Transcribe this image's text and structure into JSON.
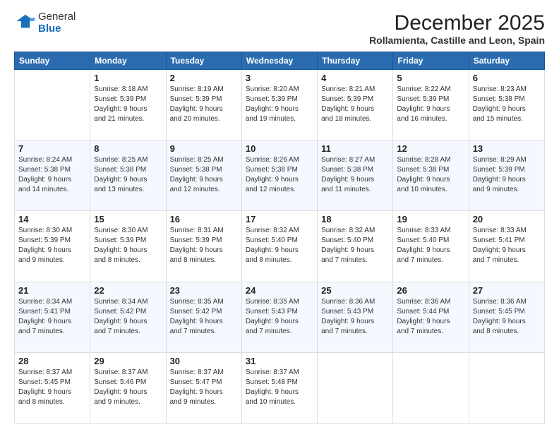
{
  "logo": {
    "general": "General",
    "blue": "Blue"
  },
  "title": "December 2025",
  "subtitle": "Rollamienta, Castille and Leon, Spain",
  "headers": [
    "Sunday",
    "Monday",
    "Tuesday",
    "Wednesday",
    "Thursday",
    "Friday",
    "Saturday"
  ],
  "weeks": [
    [
      {
        "day": "",
        "lines": []
      },
      {
        "day": "1",
        "lines": [
          "Sunrise: 8:18 AM",
          "Sunset: 5:39 PM",
          "Daylight: 9 hours",
          "and 21 minutes."
        ]
      },
      {
        "day": "2",
        "lines": [
          "Sunrise: 8:19 AM",
          "Sunset: 5:39 PM",
          "Daylight: 9 hours",
          "and 20 minutes."
        ]
      },
      {
        "day": "3",
        "lines": [
          "Sunrise: 8:20 AM",
          "Sunset: 5:39 PM",
          "Daylight: 9 hours",
          "and 19 minutes."
        ]
      },
      {
        "day": "4",
        "lines": [
          "Sunrise: 8:21 AM",
          "Sunset: 5:39 PM",
          "Daylight: 9 hours",
          "and 18 minutes."
        ]
      },
      {
        "day": "5",
        "lines": [
          "Sunrise: 8:22 AM",
          "Sunset: 5:39 PM",
          "Daylight: 9 hours",
          "and 16 minutes."
        ]
      },
      {
        "day": "6",
        "lines": [
          "Sunrise: 8:23 AM",
          "Sunset: 5:38 PM",
          "Daylight: 9 hours",
          "and 15 minutes."
        ]
      }
    ],
    [
      {
        "day": "7",
        "lines": [
          "Sunrise: 8:24 AM",
          "Sunset: 5:38 PM",
          "Daylight: 9 hours",
          "and 14 minutes."
        ]
      },
      {
        "day": "8",
        "lines": [
          "Sunrise: 8:25 AM",
          "Sunset: 5:38 PM",
          "Daylight: 9 hours",
          "and 13 minutes."
        ]
      },
      {
        "day": "9",
        "lines": [
          "Sunrise: 8:25 AM",
          "Sunset: 5:38 PM",
          "Daylight: 9 hours",
          "and 12 minutes."
        ]
      },
      {
        "day": "10",
        "lines": [
          "Sunrise: 8:26 AM",
          "Sunset: 5:38 PM",
          "Daylight: 9 hours",
          "and 12 minutes."
        ]
      },
      {
        "day": "11",
        "lines": [
          "Sunrise: 8:27 AM",
          "Sunset: 5:38 PM",
          "Daylight: 9 hours",
          "and 11 minutes."
        ]
      },
      {
        "day": "12",
        "lines": [
          "Sunrise: 8:28 AM",
          "Sunset: 5:38 PM",
          "Daylight: 9 hours",
          "and 10 minutes."
        ]
      },
      {
        "day": "13",
        "lines": [
          "Sunrise: 8:29 AM",
          "Sunset: 5:39 PM",
          "Daylight: 9 hours",
          "and 9 minutes."
        ]
      }
    ],
    [
      {
        "day": "14",
        "lines": [
          "Sunrise: 8:30 AM",
          "Sunset: 5:39 PM",
          "Daylight: 9 hours",
          "and 9 minutes."
        ]
      },
      {
        "day": "15",
        "lines": [
          "Sunrise: 8:30 AM",
          "Sunset: 5:39 PM",
          "Daylight: 9 hours",
          "and 8 minutes."
        ]
      },
      {
        "day": "16",
        "lines": [
          "Sunrise: 8:31 AM",
          "Sunset: 5:39 PM",
          "Daylight: 9 hours",
          "and 8 minutes."
        ]
      },
      {
        "day": "17",
        "lines": [
          "Sunrise: 8:32 AM",
          "Sunset: 5:40 PM",
          "Daylight: 9 hours",
          "and 8 minutes."
        ]
      },
      {
        "day": "18",
        "lines": [
          "Sunrise: 8:32 AM",
          "Sunset: 5:40 PM",
          "Daylight: 9 hours",
          "and 7 minutes."
        ]
      },
      {
        "day": "19",
        "lines": [
          "Sunrise: 8:33 AM",
          "Sunset: 5:40 PM",
          "Daylight: 9 hours",
          "and 7 minutes."
        ]
      },
      {
        "day": "20",
        "lines": [
          "Sunrise: 8:33 AM",
          "Sunset: 5:41 PM",
          "Daylight: 9 hours",
          "and 7 minutes."
        ]
      }
    ],
    [
      {
        "day": "21",
        "lines": [
          "Sunrise: 8:34 AM",
          "Sunset: 5:41 PM",
          "Daylight: 9 hours",
          "and 7 minutes."
        ]
      },
      {
        "day": "22",
        "lines": [
          "Sunrise: 8:34 AM",
          "Sunset: 5:42 PM",
          "Daylight: 9 hours",
          "and 7 minutes."
        ]
      },
      {
        "day": "23",
        "lines": [
          "Sunrise: 8:35 AM",
          "Sunset: 5:42 PM",
          "Daylight: 9 hours",
          "and 7 minutes."
        ]
      },
      {
        "day": "24",
        "lines": [
          "Sunrise: 8:35 AM",
          "Sunset: 5:43 PM",
          "Daylight: 9 hours",
          "and 7 minutes."
        ]
      },
      {
        "day": "25",
        "lines": [
          "Sunrise: 8:36 AM",
          "Sunset: 5:43 PM",
          "Daylight: 9 hours",
          "and 7 minutes."
        ]
      },
      {
        "day": "26",
        "lines": [
          "Sunrise: 8:36 AM",
          "Sunset: 5:44 PM",
          "Daylight: 9 hours",
          "and 7 minutes."
        ]
      },
      {
        "day": "27",
        "lines": [
          "Sunrise: 8:36 AM",
          "Sunset: 5:45 PM",
          "Daylight: 9 hours",
          "and 8 minutes."
        ]
      }
    ],
    [
      {
        "day": "28",
        "lines": [
          "Sunrise: 8:37 AM",
          "Sunset: 5:45 PM",
          "Daylight: 9 hours",
          "and 8 minutes."
        ]
      },
      {
        "day": "29",
        "lines": [
          "Sunrise: 8:37 AM",
          "Sunset: 5:46 PM",
          "Daylight: 9 hours",
          "and 9 minutes."
        ]
      },
      {
        "day": "30",
        "lines": [
          "Sunrise: 8:37 AM",
          "Sunset: 5:47 PM",
          "Daylight: 9 hours",
          "and 9 minutes."
        ]
      },
      {
        "day": "31",
        "lines": [
          "Sunrise: 8:37 AM",
          "Sunset: 5:48 PM",
          "Daylight: 9 hours",
          "and 10 minutes."
        ]
      },
      {
        "day": "",
        "lines": []
      },
      {
        "day": "",
        "lines": []
      },
      {
        "day": "",
        "lines": []
      }
    ]
  ]
}
